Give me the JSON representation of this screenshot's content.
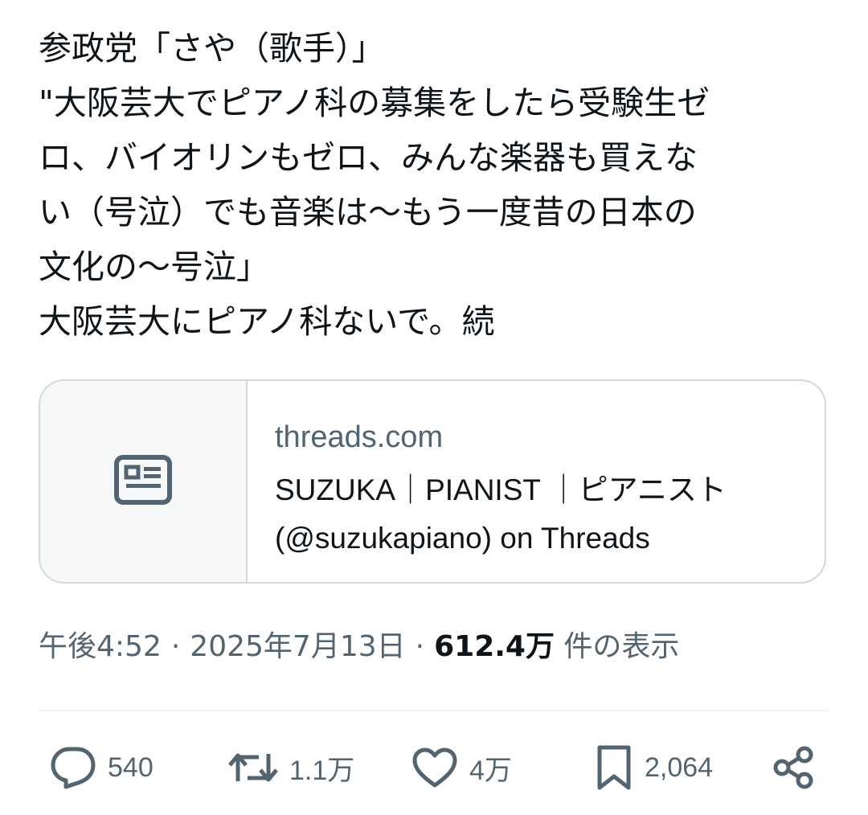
{
  "tweet": {
    "lines": [
      "参政党「さや（歌手）」",
      "\"大阪芸大でピアノ科の募集をしたら受験生ゼ",
      "ロ、バイオリンもゼロ、みんな楽器も買えな",
      "い（号泣）でも音楽は〜もう一度昔の日本の",
      "文化の〜号泣」",
      "大阪芸大にピアノ科ないで。続"
    ]
  },
  "card": {
    "domain": "threads.com",
    "title_lines": [
      "SUZUKA｜PIANIST ｜ピアニスト",
      "(@suzukapiano) on Threads"
    ],
    "icon": "article-icon"
  },
  "meta": {
    "time": "午後4:52",
    "separator": "·",
    "date": "2025年7月13日",
    "views_count": "612.4万",
    "views_label": "件の表示"
  },
  "actions": {
    "replies": "540",
    "reposts": "1.1万",
    "likes": "4万",
    "bookmarks": "2,064"
  },
  "icons": {
    "reply": "reply-icon",
    "repost": "repost-icon",
    "like": "heart-icon",
    "bookmark": "bookmark-icon",
    "share": "share-icon"
  },
  "colors": {
    "text": "#0f1419",
    "secondary": "#536471",
    "border": "#cfd9de"
  }
}
